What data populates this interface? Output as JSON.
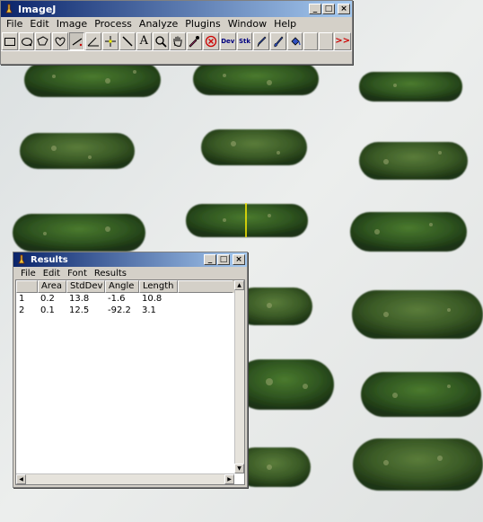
{
  "imagej": {
    "title": "ImageJ",
    "window_controls": [
      "_",
      "□",
      "×"
    ],
    "menu": [
      "File",
      "Edit",
      "Image",
      "Process",
      "Analyze",
      "Plugins",
      "Window",
      "Help"
    ],
    "tools": [
      {
        "name": "rectangle-tool",
        "label": ""
      },
      {
        "name": "oval-tool",
        "label": ""
      },
      {
        "name": "polygon-tool",
        "label": ""
      },
      {
        "name": "freehand-tool",
        "label": ""
      },
      {
        "name": "line-tool",
        "label": ""
      },
      {
        "name": "angle-tool",
        "label": ""
      },
      {
        "name": "point-tool",
        "label": ""
      },
      {
        "name": "wand-tool",
        "label": ""
      },
      {
        "name": "text-tool",
        "label": "A"
      },
      {
        "name": "magnifier-tool",
        "label": ""
      },
      {
        "name": "hand-tool",
        "label": ""
      },
      {
        "name": "color-picker-tool",
        "label": ""
      },
      {
        "name": "stop-tool",
        "label": ""
      },
      {
        "name": "developer-menu-tool",
        "label": "Dev"
      },
      {
        "name": "stack-tool",
        "label": "Stk"
      },
      {
        "name": "pencil-tool",
        "label": ""
      },
      {
        "name": "brush-tool",
        "label": ""
      },
      {
        "name": "flood-fill-tool",
        "label": ""
      },
      {
        "name": "more-tools",
        "label": ">>"
      }
    ]
  },
  "results": {
    "title": "Results",
    "menu": [
      "File",
      "Edit",
      "Font",
      "Results"
    ],
    "columns": [
      "",
      "Area",
      "StdDev",
      "Angle",
      "Length"
    ],
    "rows": [
      [
        "1",
        "0.2",
        "13.8",
        "-1.6",
        "10.8"
      ],
      [
        "2",
        "0.1",
        "12.5",
        "-92.2",
        "3.1"
      ]
    ]
  }
}
